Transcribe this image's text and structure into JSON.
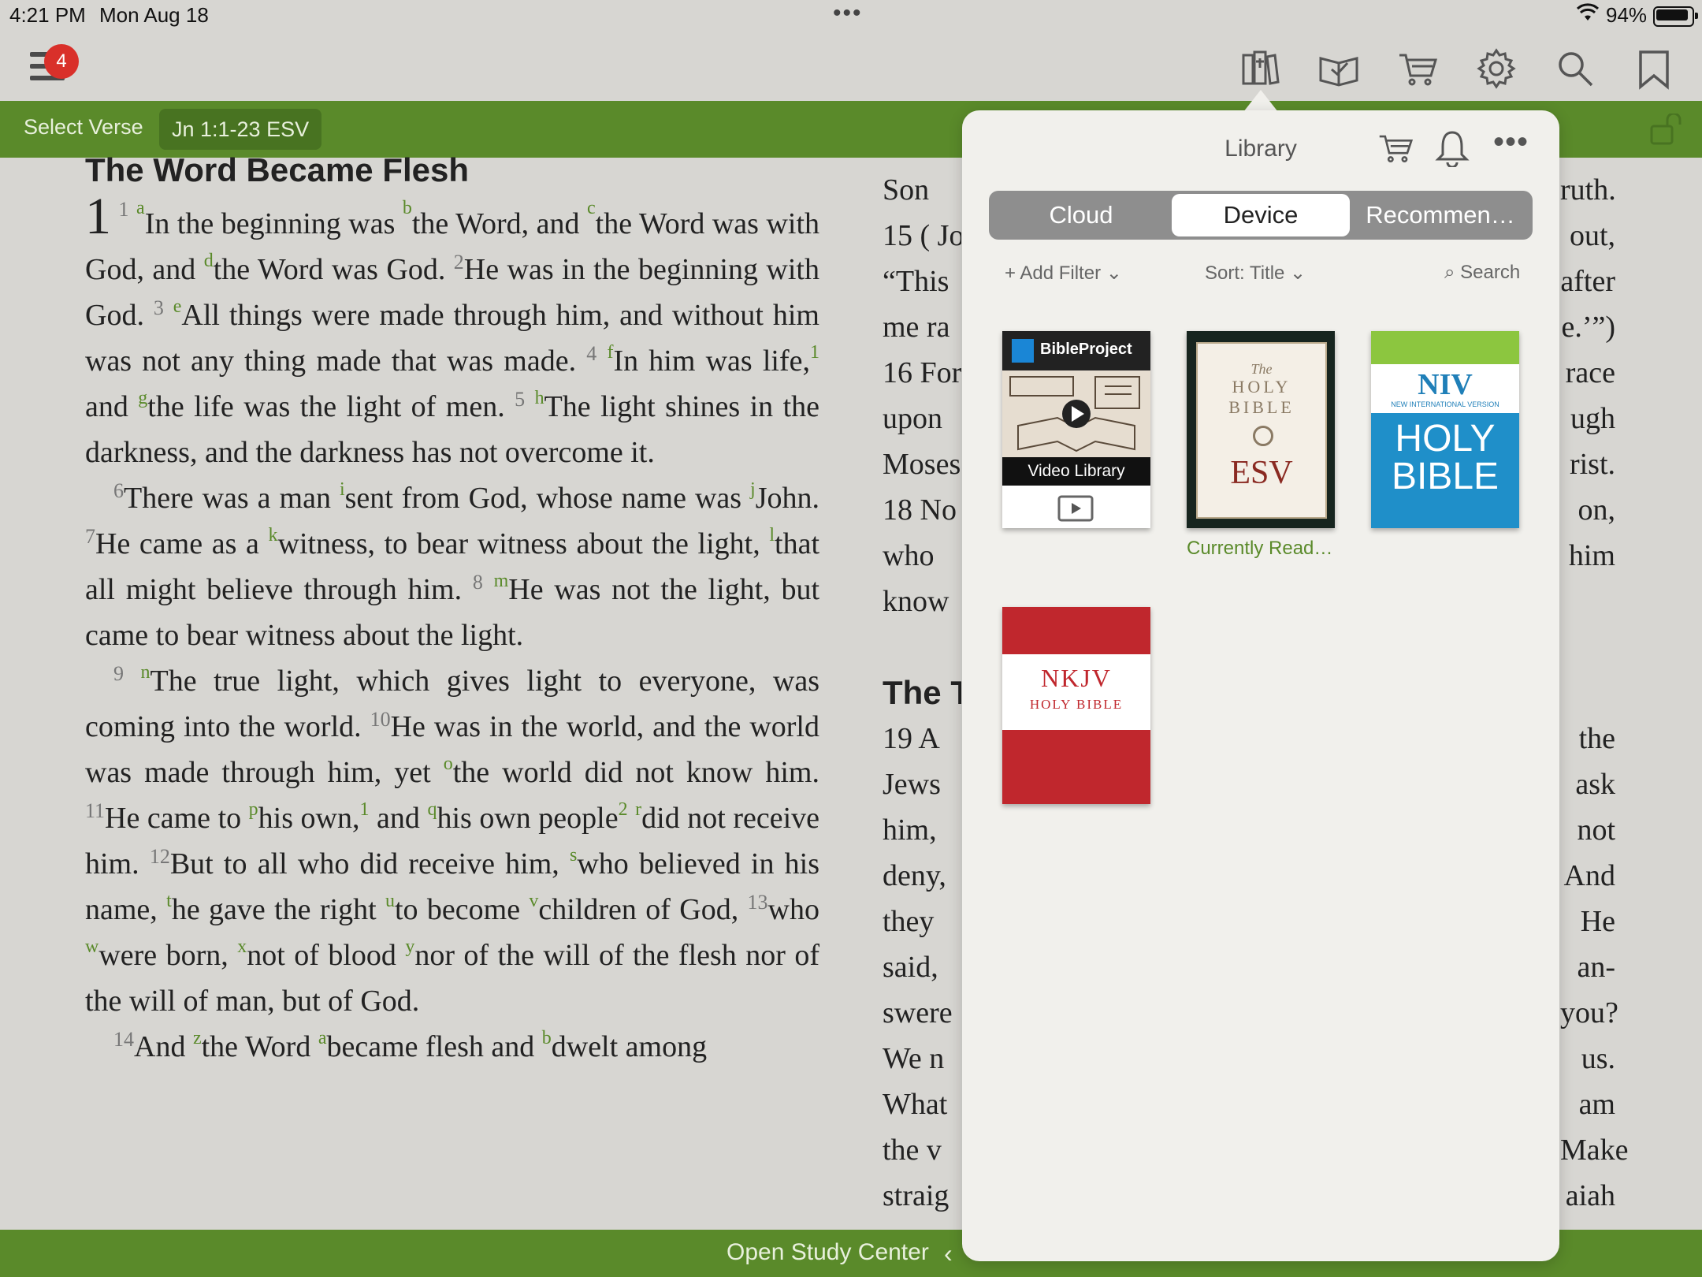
{
  "status": {
    "time": "4:21 PM",
    "date": "Mon Aug 18",
    "battery": "94%"
  },
  "toolbar": {
    "notification_count": "4"
  },
  "greenbar": {
    "select_verse": "Select Verse",
    "reference": "Jn 1:1-23 ESV"
  },
  "bottombar": {
    "open_study_center": "Open Study Center"
  },
  "passage": {
    "heading": "The Word Became Flesh",
    "chapter": "1"
  },
  "right_column": {
    "left_fragments": [
      "Son",
      "15 ( Jo",
      "“This",
      "me ra",
      "16 For",
      "upon",
      "Moses",
      "18 No",
      "who",
      "know",
      "",
      "The T",
      "19 A",
      "Jews",
      "him,",
      "deny,",
      "they",
      "said,",
      "swere",
      "We n",
      "What",
      "the v",
      "straig"
    ],
    "right_fragments": [
      "ruth.",
      "out,",
      "after",
      "e.’”)",
      "race",
      "ugh",
      "rist.",
      "on,",
      "him",
      "",
      "",
      "",
      "the",
      "ask",
      "not",
      "And",
      "He",
      "an-",
      "you?",
      "us.",
      "am",
      "Make",
      "aiah"
    ]
  },
  "library": {
    "title": "Library",
    "tabs": [
      "Cloud",
      "Device",
      "Recommen…"
    ],
    "active_tab": "Device",
    "add_filter": "+ Add Filter",
    "sort": "Sort: Title",
    "search": "Search",
    "books": [
      {
        "id": "bibleproject",
        "brand": "BibleProject",
        "label": "Video Library"
      },
      {
        "id": "esv",
        "line1": "The",
        "line2": "HOLY",
        "line3": "BIBLE",
        "line4": "ESV",
        "caption": "Currently Read…"
      },
      {
        "id": "niv",
        "brand": "NIV",
        "sub": "NEW INTERNATIONAL VERSION",
        "line1": "HOLY",
        "line2": "BIBLE"
      },
      {
        "id": "nkjv",
        "brand": "NKJV",
        "sub": "HOLY BIBLE"
      }
    ]
  },
  "colors": {
    "green": "#5a8a2a",
    "badge": "#d9302a",
    "niv_blue": "#1f8fc9",
    "nkjv_red": "#c0272d"
  }
}
